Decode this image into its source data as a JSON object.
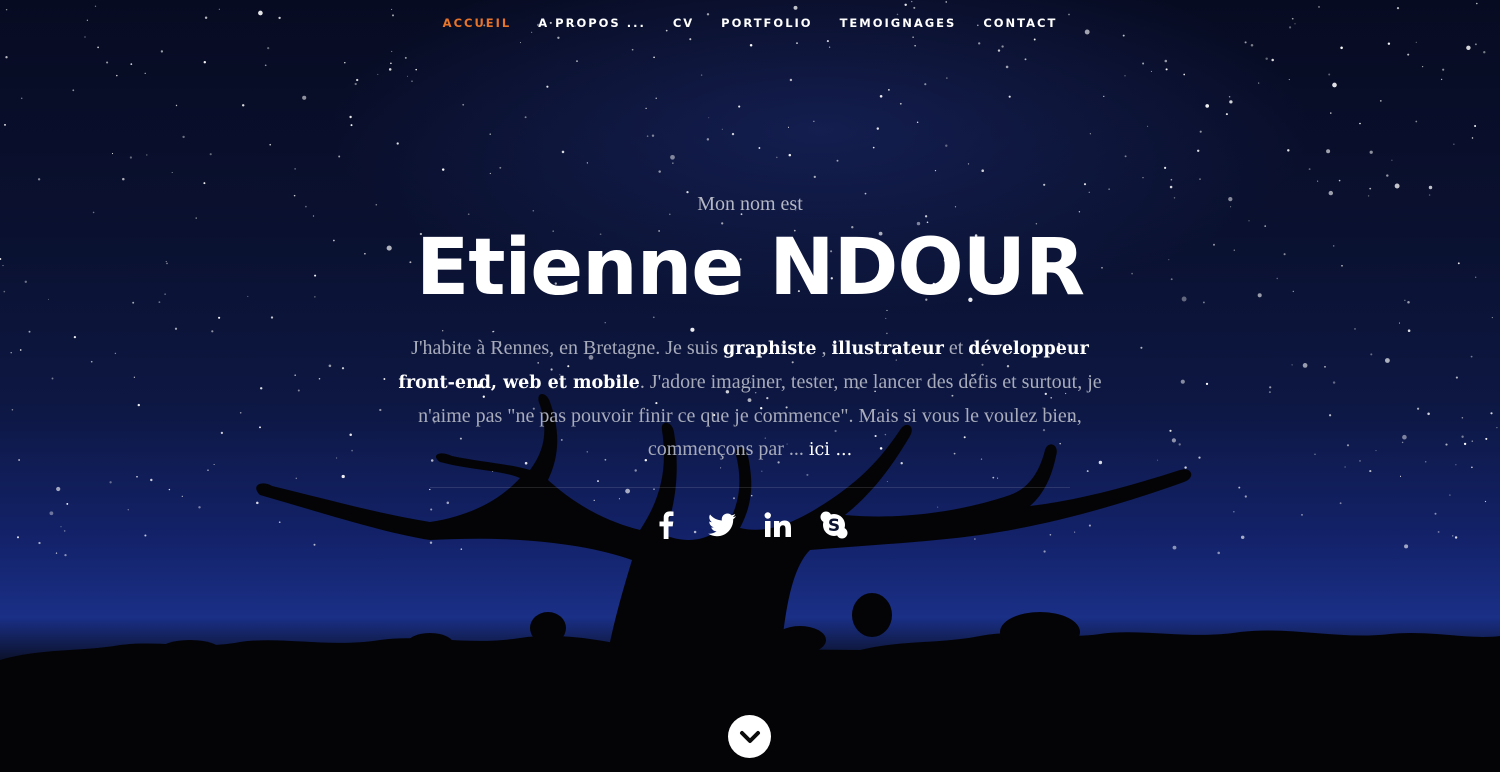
{
  "colors": {
    "accent": "#e8742a",
    "nav_text": "#ffffff",
    "intro_text": "#b4b7c4",
    "body_text": "#a7abba",
    "highlight": "#ffffff"
  },
  "nav": {
    "items": [
      {
        "label": "ACCUEIL",
        "active": true
      },
      {
        "label": "A PROPOS ...",
        "active": false
      },
      {
        "label": "CV",
        "active": false
      },
      {
        "label": "PORTFOLIO",
        "active": false
      },
      {
        "label": "TEMOIGNAGES",
        "active": false
      },
      {
        "label": "CONTACT",
        "active": false
      }
    ]
  },
  "hero": {
    "intro": "Mon nom est",
    "name": "Etienne NDOUR",
    "bio": {
      "t1": "J'habite à Rennes, en Bretagne. Je suis ",
      "h1": "graphiste",
      "t2": " , ",
      "h2": "illustrateur",
      "t3": " et ",
      "h3": "développeur front-end, web et mobile",
      "t4": ". J'adore imaginer, tester, me lancer des défis et surtout, je n'aime pas \"ne pas pouvoir finir ce que je commence\". Mais si vous le voulez bien, commençons par ... ",
      "link": "ici ..."
    }
  },
  "social": {
    "icons": [
      "facebook-icon",
      "twitter-icon",
      "linkedin-icon",
      "skype-icon"
    ]
  },
  "scroll": {
    "icon": "chevron-down-icon"
  }
}
